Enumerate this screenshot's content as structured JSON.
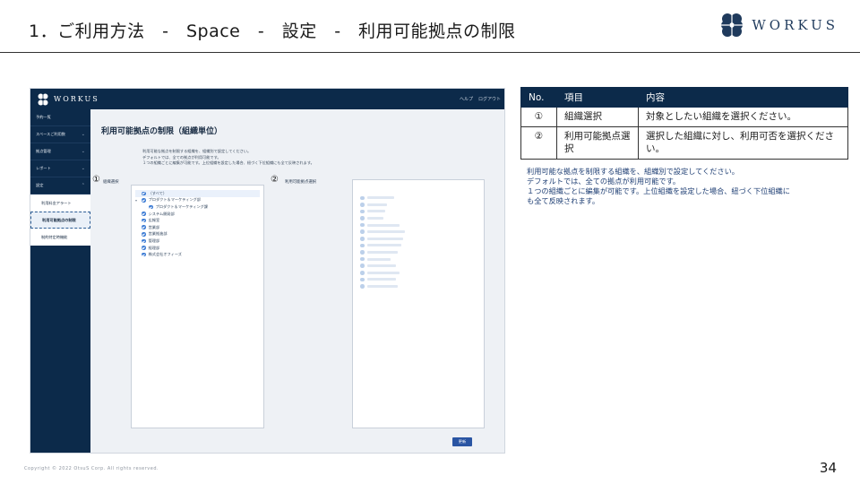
{
  "slide": {
    "title": "1．ご利用方法　-　Space　-　設定　-　利用可能拠点の制限",
    "brand_name": "WORKUS",
    "page_number": "34",
    "copyright": "Copyright © 2022 OtsuS Corp. All rights reserved."
  },
  "screenshot": {
    "header": {
      "logo_text": "WORKUS",
      "links": [
        "ヘルプ",
        "ログアウト"
      ]
    },
    "sidebar": {
      "items": [
        "予約一覧",
        "スペースご利用数",
        "拠点管理",
        "レポート",
        "設定"
      ],
      "subitems": [
        "利用料金アラート",
        "利用可能拠点の制限",
        "制約特定時機能"
      ],
      "active_subitem": "利用可能拠点の制限"
    },
    "main": {
      "title": "利用可能拠点の制限（組織単位）",
      "description": [
        "利用可能な拠点を制限する組織を、組織別で設定してください。",
        "デフォルトでは、全ての拠点が利用可能です。",
        "１つの組織ごとに編集が可能です。上位組織を設定した場合、紐づく下位組織にも全て反映されます。"
      ],
      "org_panel_marker": "①",
      "org_panel_label": "組織選択",
      "site_panel_marker": "②",
      "site_panel_label": "利用可能拠点選択",
      "org_list": [
        {
          "label": "（すべて）",
          "indent": 0
        },
        {
          "label": "プロダクト＆マーケティング部",
          "indent": 0
        },
        {
          "label": "プロダクト＆マーケティング課",
          "indent": 1
        },
        {
          "label": "システム開発部",
          "indent": 0
        },
        {
          "label": "広報室",
          "indent": 0
        },
        {
          "label": "営業部",
          "indent": 0
        },
        {
          "label": "営業推進部",
          "indent": 0
        },
        {
          "label": "管理部",
          "indent": 0
        },
        {
          "label": "経理部",
          "indent": 0
        },
        {
          "label": "株式会社オフィーズ",
          "indent": 0
        }
      ],
      "site_list_count": 14,
      "update_button": "更新"
    }
  },
  "table": {
    "headers": [
      "No.",
      "項目",
      "内容"
    ],
    "rows": [
      {
        "no": "①",
        "item": "組織選択",
        "content": "対象としたい組織を選択ください。"
      },
      {
        "no": "②",
        "item": "利用可能拠点選択",
        "content": "選択した組織に対し、利用可否を選択ください。"
      }
    ]
  },
  "note": [
    "利用可能な拠点を制限する組織を、組織別で設定してください。",
    "デフォルトでは、全ての拠点が利用可能です。",
    "１つの組織ごとに編集が可能です。上位組織を設定した場合、紐づく下位組織に",
    "も全て反映されます。"
  ],
  "colors": {
    "navy": "#0c2a4a",
    "accent_blue": "#3b7bd4",
    "note_text": "#1f3f74"
  }
}
